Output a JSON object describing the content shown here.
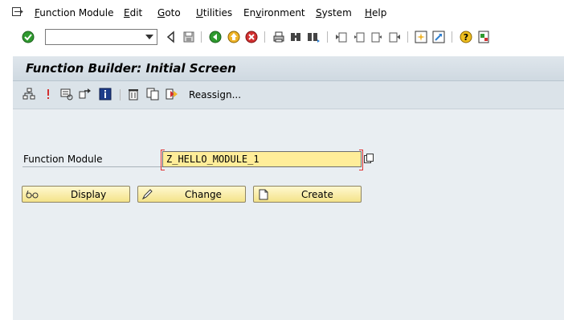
{
  "menubar": {
    "items": [
      "Function Module",
      "Edit",
      "Goto",
      "Utilities",
      "Environment",
      "System",
      "Help"
    ],
    "mnemonics": [
      "F",
      "E",
      "G",
      "U",
      "v",
      "S",
      "H"
    ]
  },
  "toolbar": {
    "command_field_value": "",
    "icons": [
      "enter-icon",
      "back-arrow-icon",
      "save-icon",
      "back-icon",
      "exit-icon",
      "cancel-icon",
      "print-icon",
      "find-icon",
      "find-next-icon",
      "first-page-icon",
      "previous-page-icon",
      "next-page-icon",
      "last-page-icon",
      "create-session-icon",
      "shortcut-icon",
      "help-icon",
      "customize-layout-icon"
    ]
  },
  "screen": {
    "title": "Function Builder: Initial Screen"
  },
  "app_toolbar": {
    "icons": [
      "hierarchy-icon",
      "check-icon",
      "where-used-icon",
      "transfer-icon",
      "info-icon",
      "delete-icon",
      "copy-icon",
      "rename-icon"
    ],
    "reassign_label": "Reassign..."
  },
  "form": {
    "function_module_label": "Function Module",
    "function_module_value": "Z_HELLO_MODULE_1"
  },
  "buttons": {
    "display_label": "Display",
    "change_label": "Change",
    "create_label": "Create"
  },
  "colors": {
    "background": "#e9eef2",
    "title_bar": "#dfe6ec",
    "input_yellow": "#ffed99",
    "button_yellow": "#f4e38a",
    "required_red": "#e03030"
  }
}
